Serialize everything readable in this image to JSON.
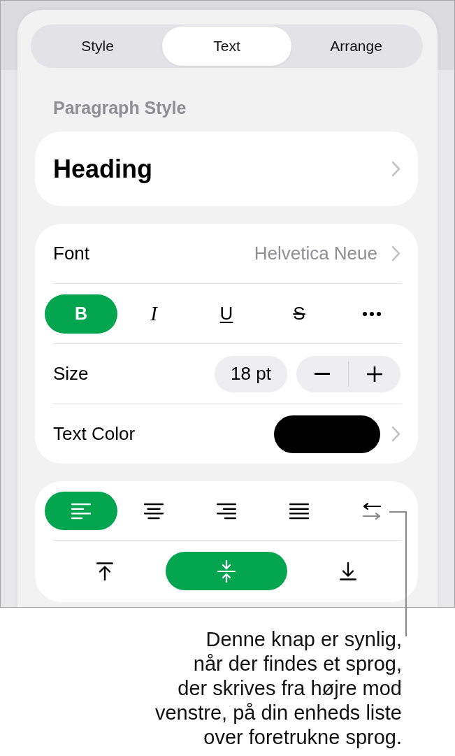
{
  "tabs": [
    {
      "label": "Style",
      "selected": false
    },
    {
      "label": "Text",
      "selected": true
    },
    {
      "label": "Arrange",
      "selected": false
    }
  ],
  "paragraph_style": {
    "title": "Paragraph Style",
    "value": "Heading"
  },
  "font": {
    "label": "Font",
    "value": "Helvetica Neue"
  },
  "text_styles": [
    {
      "kind": "bold",
      "label": "B",
      "selected": true
    },
    {
      "kind": "italic",
      "label": "I",
      "selected": false
    },
    {
      "kind": "underline",
      "label": "U",
      "selected": false
    },
    {
      "kind": "strikethrough",
      "label": "S",
      "selected": false
    },
    {
      "kind": "more",
      "selected": false
    }
  ],
  "size": {
    "label": "Size",
    "value": "18 pt"
  },
  "text_color": {
    "label": "Text Color",
    "color": "#000000"
  },
  "alignment": [
    {
      "kind": "left",
      "selected": true
    },
    {
      "kind": "center",
      "selected": false
    },
    {
      "kind": "right",
      "selected": false
    },
    {
      "kind": "justify",
      "selected": false
    }
  ],
  "vertical_alignment": [
    {
      "kind": "top",
      "selected": false
    },
    {
      "kind": "middle",
      "selected": true
    },
    {
      "kind": "bottom",
      "selected": false
    }
  ],
  "callout": {
    "lines": [
      "Denne knap er synlig,",
      "når der findes et sprog,",
      "der skrives fra højre mod",
      "venstre, på din enheds liste",
      "over foretrukne sprog."
    ]
  }
}
